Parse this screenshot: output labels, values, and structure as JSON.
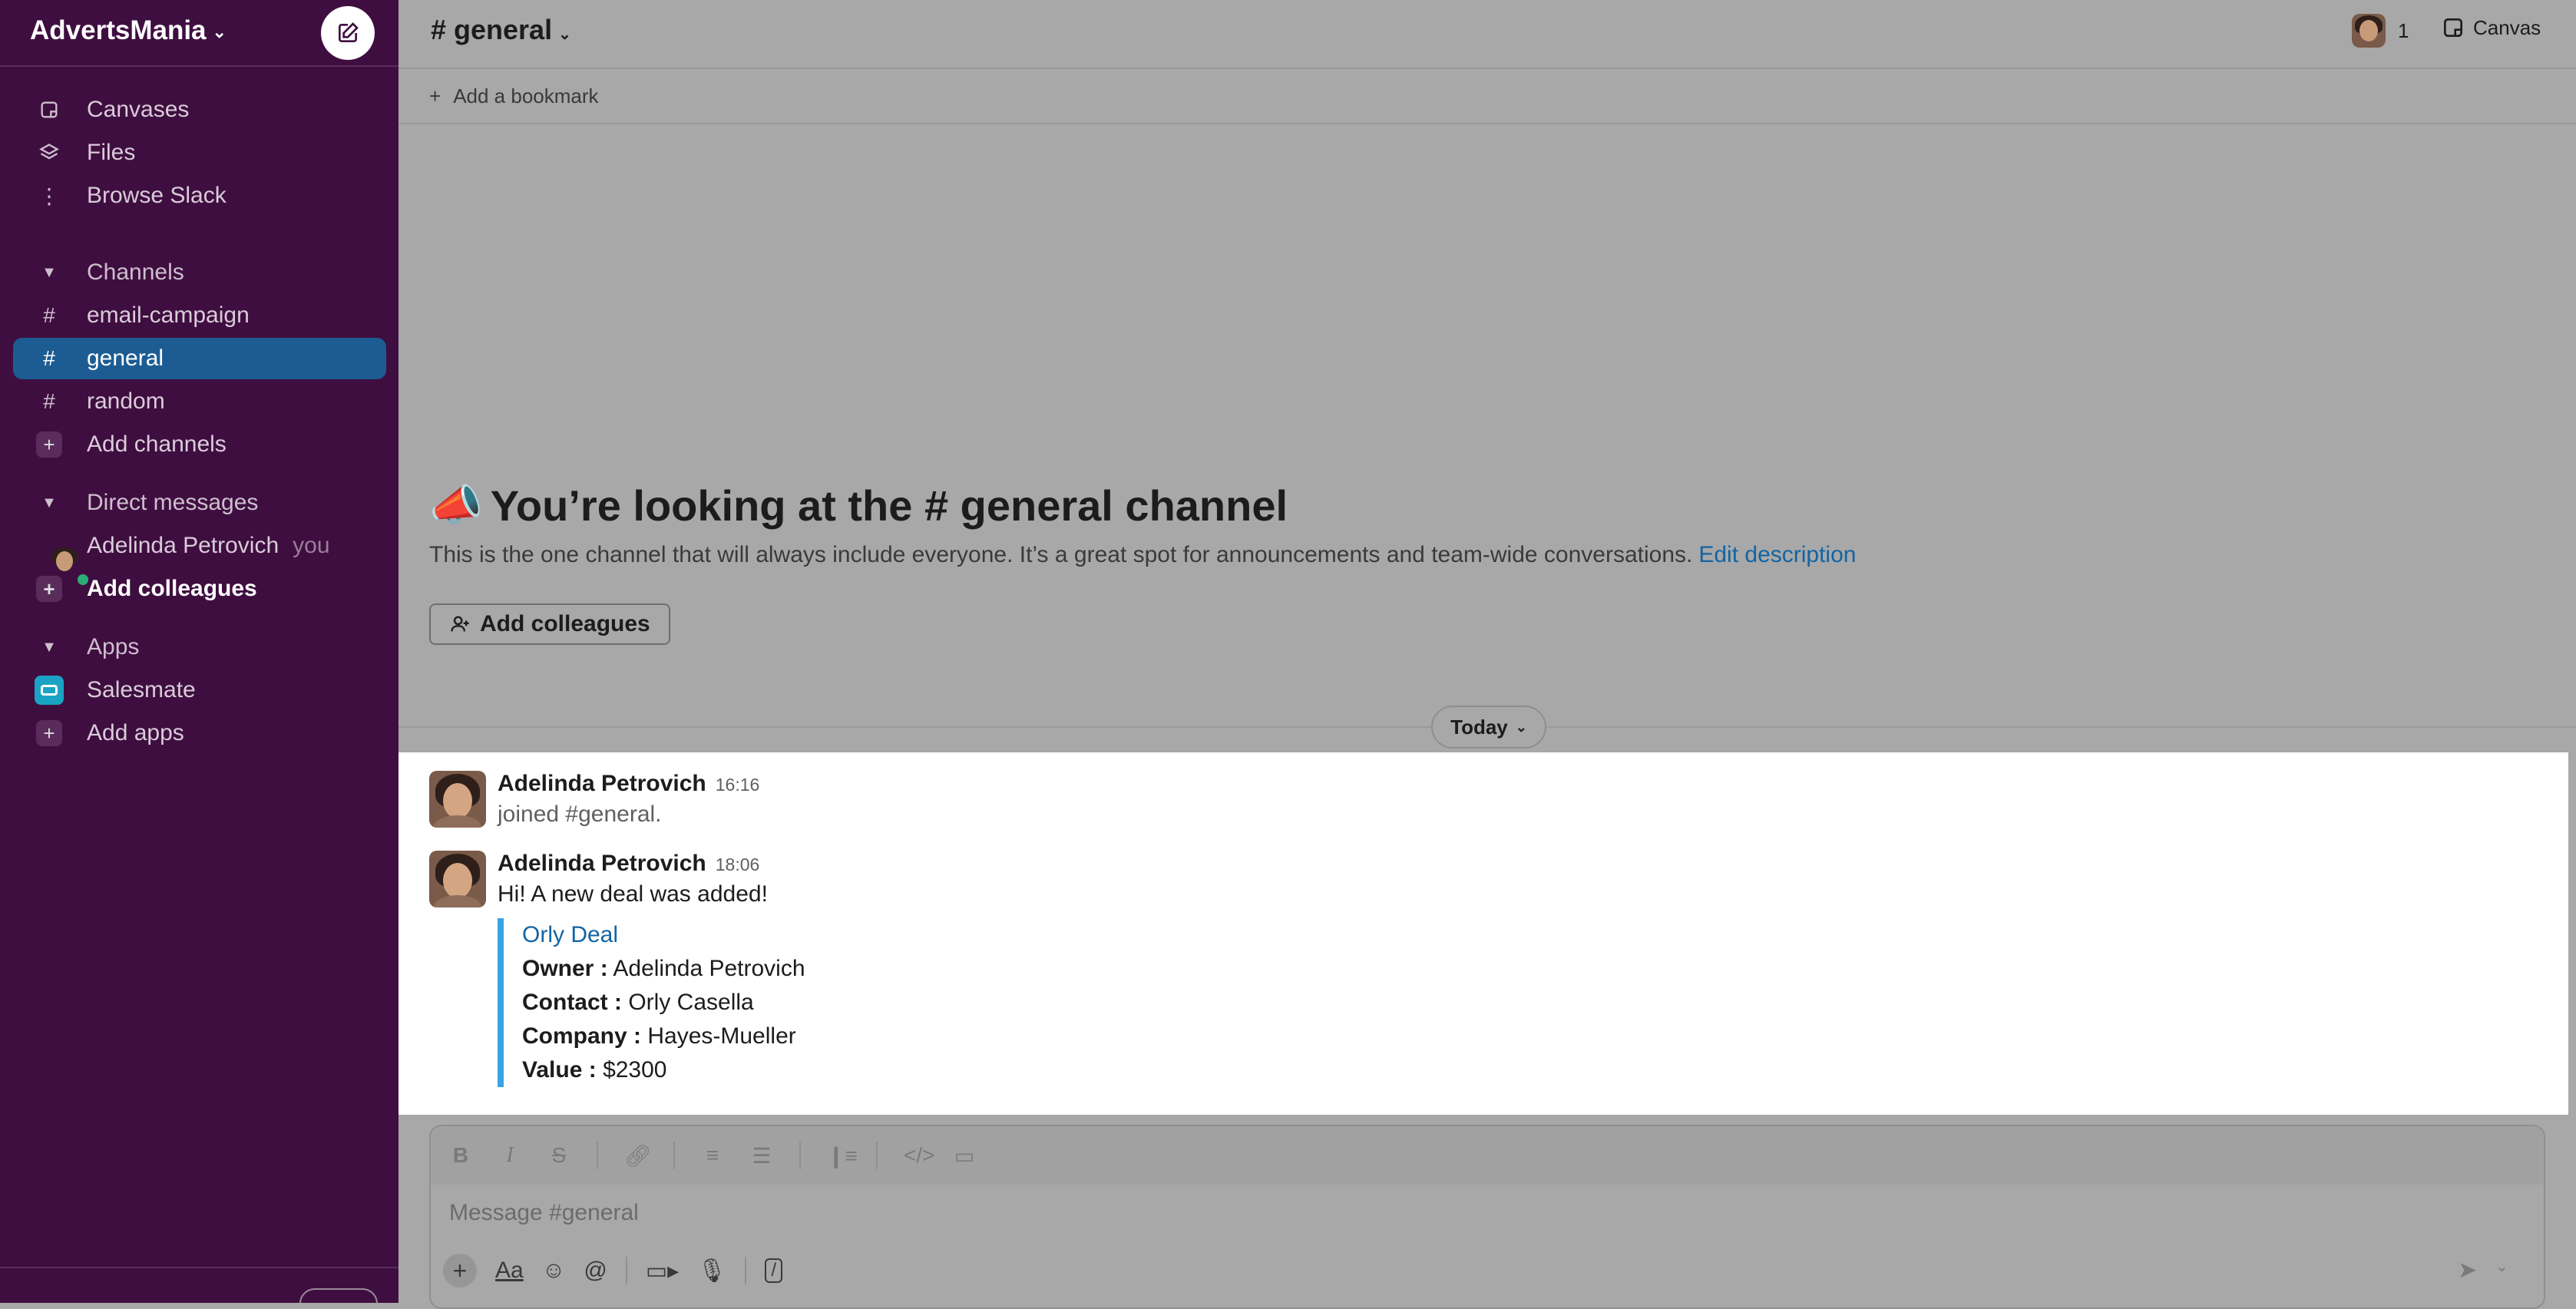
{
  "workspace": {
    "name": "AdvertsMania"
  },
  "sidebar": {
    "top_items": [
      {
        "label": "Canvases",
        "icon": "canvases-icon"
      },
      {
        "label": "Files",
        "icon": "files-icon"
      },
      {
        "label": "Browse Slack",
        "icon": "more-icon"
      }
    ],
    "channels_header": "Channels",
    "channels": [
      {
        "label": "email-campaign"
      },
      {
        "label": "general",
        "active": true
      },
      {
        "label": "random"
      }
    ],
    "add_channels": "Add channels",
    "dm_header": "Direct messages",
    "dm_user": "Adelinda Petrovich",
    "dm_you": "you",
    "add_colleagues": "Add colleagues",
    "apps_header": "Apps",
    "app": "Salesmate",
    "add_apps": "Add apps"
  },
  "header": {
    "channel_title": "# general",
    "member_count": "1",
    "canvas_label": "Canvas"
  },
  "bookmark": {
    "label": "Add a bookmark"
  },
  "intro": {
    "title": "You’re looking at the # general channel",
    "description": "This is the one channel that will always include everyone. It’s a great spot for announcements and team-wide conversations.",
    "edit_link": "Edit description",
    "add_colleagues_button": "Add colleagues"
  },
  "date_divider": "Today",
  "messages": [
    {
      "author": "Adelinda Petrovich",
      "time": "16:16",
      "text": "joined #general."
    },
    {
      "author": "Adelinda Petrovich",
      "time": "18:06",
      "text": "Hi! A new deal was added!",
      "attachment": {
        "title": "Orly Deal",
        "fields": [
          {
            "label": "Owner :",
            "value": "Adelinda Petrovich"
          },
          {
            "label": "Contact :",
            "value": "Orly Casella"
          },
          {
            "label": "Company :",
            "value": "Hayes-Mueller"
          },
          {
            "label": "Value :",
            "value": "$2300"
          }
        ]
      }
    }
  ],
  "composer": {
    "placeholder": "Message #general"
  },
  "colors": {
    "sidebar": "#3f0e40",
    "active": "#1d5c93",
    "link": "#1264a3",
    "attachment_bar": "#3aa3e3"
  }
}
